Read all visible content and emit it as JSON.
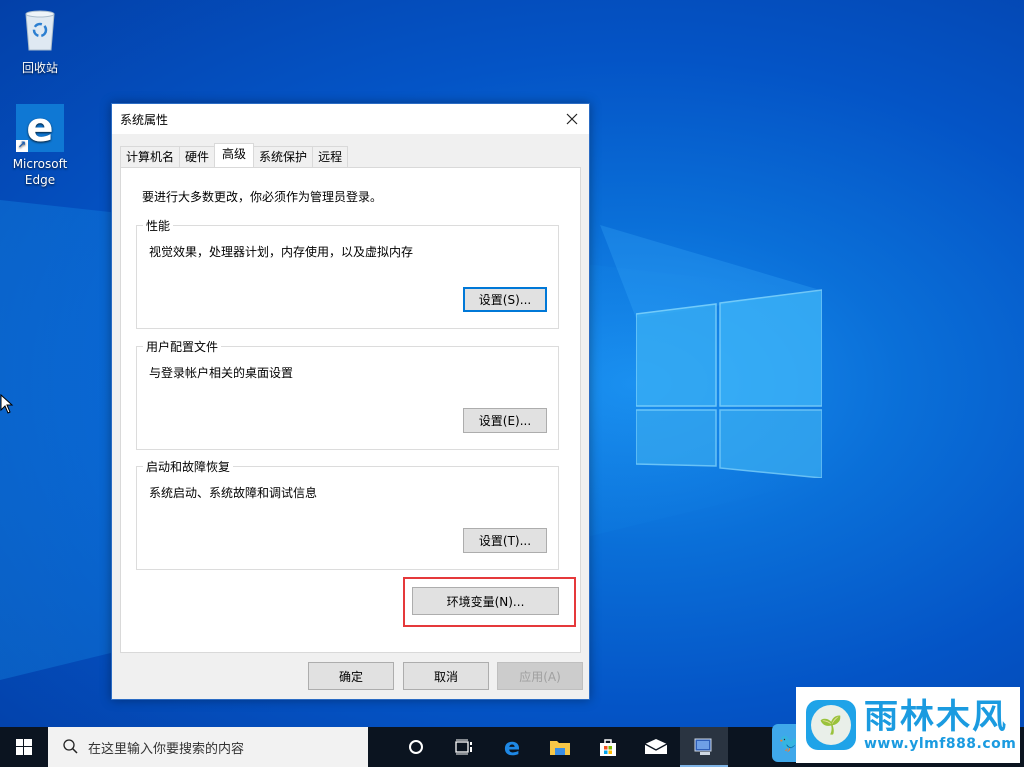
{
  "desktop": {
    "icons": [
      {
        "label": "回收站",
        "icon": "recycle-bin-icon"
      },
      {
        "label": "Microsoft Edge",
        "icon": "edge-icon"
      }
    ]
  },
  "dialog": {
    "title": "系统属性",
    "close_label": "✕",
    "tabs": [
      {
        "label": "计算机名",
        "active": false
      },
      {
        "label": "硬件",
        "active": false
      },
      {
        "label": "高级",
        "active": true
      },
      {
        "label": "系统保护",
        "active": false
      },
      {
        "label": "远程",
        "active": false
      }
    ],
    "notice": "要进行大多数更改，你必须作为管理员登录。",
    "groups": [
      {
        "legend": "性能",
        "description": "视觉效果，处理器计划，内存使用，以及虚拟内存",
        "button": "设置(S)..."
      },
      {
        "legend": "用户配置文件",
        "description": "与登录帐户相关的桌面设置",
        "button": "设置(E)..."
      },
      {
        "legend": "启动和故障恢复",
        "description": "系统启动、系统故障和调试信息",
        "button": "设置(T)..."
      }
    ],
    "env_button": "环境变量(N)...",
    "footer": {
      "ok": "确定",
      "cancel": "取消",
      "apply": "应用(A)"
    },
    "highlight_color": "#e5393b"
  },
  "taskbar": {
    "search_placeholder": "在这里输入你要搜索的内容",
    "items": [
      {
        "name": "cortana",
        "icon": "cortana-circle-icon"
      },
      {
        "name": "task-view",
        "icon": "task-view-icon"
      },
      {
        "name": "edge",
        "icon": "edge-icon"
      },
      {
        "name": "file-explorer",
        "icon": "folder-icon"
      },
      {
        "name": "store",
        "icon": "store-bag-icon"
      },
      {
        "name": "mail",
        "icon": "mail-icon"
      },
      {
        "name": "system-properties",
        "icon": "computer-icon",
        "active": true
      }
    ]
  },
  "watermark": {
    "title": "雨林木风",
    "url": "www.ylmf888.com"
  }
}
